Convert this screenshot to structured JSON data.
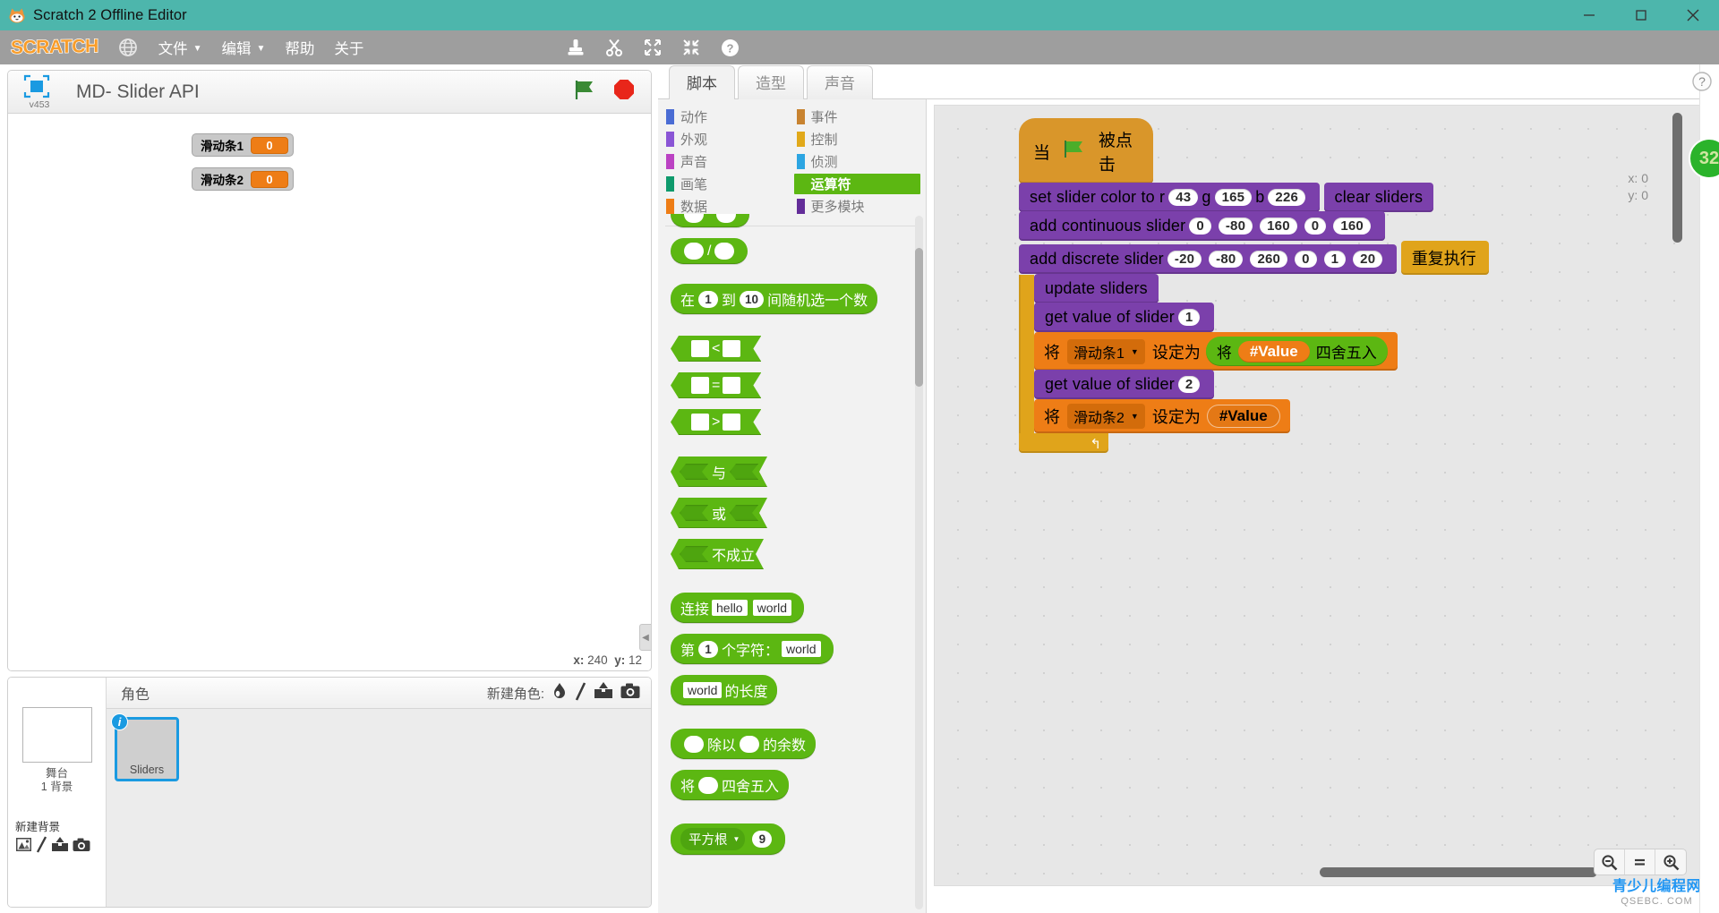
{
  "window": {
    "title": "Scratch 2 Offline Editor",
    "controls": {
      "minimize": "minimize-icon",
      "maximize": "maximize-icon",
      "close": "close-icon"
    }
  },
  "menubar": {
    "logo": "SCRATCH",
    "globe_icon": "globe-icon",
    "items": [
      {
        "label": "文件",
        "has_caret": true
      },
      {
        "label": "编辑",
        "has_caret": true
      },
      {
        "label": "帮助",
        "has_caret": false
      },
      {
        "label": "关于",
        "has_caret": false
      }
    ],
    "tools": [
      "stamp-duplicate-icon",
      "scissors-delete-icon",
      "grow-icon",
      "shrink-icon",
      "help-icon"
    ]
  },
  "stage": {
    "project_title": "MD- Slider API",
    "version_badge": "v453",
    "green_flag_icon": "green-flag-icon",
    "stop_icon": "stop-sign-icon",
    "watchers": [
      {
        "name": "滑动条1",
        "value": "0"
      },
      {
        "name": "滑动条2",
        "value": "0"
      }
    ],
    "mouse_x_label": "x:",
    "mouse_x": "240",
    "mouse_y_label": "y:",
    "mouse_y": "12"
  },
  "sprite_pane": {
    "stage_label": "舞台",
    "stage_sub": "1 背景",
    "new_backdrop_label": "新建背景",
    "backdrop_icons": [
      "library-picture-icon",
      "paint-icon",
      "upload-icon",
      "camera-icon"
    ],
    "header": "角色",
    "new_sprite_label": "新建角色:",
    "new_sprite_icons": [
      "library-sprite-icon",
      "paint-icon",
      "upload-icon",
      "camera-icon"
    ],
    "sprites": [
      {
        "name": "Sliders",
        "selected": true,
        "info_badge": "i"
      }
    ]
  },
  "editor": {
    "tabs": [
      {
        "label": "脚本",
        "active": true
      },
      {
        "label": "造型",
        "active": false
      },
      {
        "label": "声音",
        "active": false
      }
    ],
    "categories": [
      {
        "label": "动作",
        "color": "#4a6cd4",
        "active": false
      },
      {
        "label": "事件",
        "color": "#c88330",
        "active": false
      },
      {
        "label": "外观",
        "color": "#8a55d5",
        "active": false
      },
      {
        "label": "控制",
        "color": "#e1a91a",
        "active": false
      },
      {
        "label": "声音",
        "color": "#bb42c3",
        "active": false
      },
      {
        "label": "侦测",
        "color": "#2ca5e2",
        "active": false
      },
      {
        "label": "画笔",
        "color": "#0e9a6c",
        "active": false
      },
      {
        "label": "运算符",
        "color": "#5cb712",
        "active": true
      },
      {
        "label": "数据",
        "color": "#ee7d16",
        "active": false
      },
      {
        "label": "更多模块",
        "color": "#632d99",
        "active": false
      }
    ],
    "palette_blocks": {
      "multiply_op": "*",
      "divide_op": "/",
      "random": {
        "pre": "在",
        "from": "1",
        "mid": "到",
        "to": "10",
        "post": "间随机选一个数"
      },
      "less_than": "<",
      "equals": "=",
      "greater_than": ">",
      "and": "与",
      "or": "或",
      "not": "不成立",
      "join": {
        "label": "连接",
        "a": "hello",
        "b": "world"
      },
      "letter_of": {
        "pre": "第",
        "n": "1",
        "mid": "个字符：",
        "str": "world"
      },
      "length_of": {
        "str": "world",
        "post": "的长度"
      },
      "mod": {
        "pre": "除以",
        "post": "的余数"
      },
      "round": {
        "pre": "将",
        "post": "四舍五入"
      },
      "mathop": {
        "fn": "平方根",
        "n": "9"
      }
    },
    "script": {
      "hat": {
        "pre": "当",
        "icon": "green-flag-icon",
        "post": "被点击"
      },
      "set_color": {
        "pre": "set slider color to r",
        "r": "43",
        "g_label": "g",
        "g": "165",
        "b_label": "b",
        "b": "226"
      },
      "clear": "clear sliders",
      "add_continuous": {
        "label": "add continuous slider",
        "args": [
          "0",
          "-80",
          "160",
          "0",
          "160"
        ]
      },
      "add_discrete": {
        "label": "add discrete slider",
        "args": [
          "-20",
          "-80",
          "260",
          "0",
          "1",
          "20"
        ]
      },
      "forever": "重复执行",
      "update": "update sliders",
      "get_slider_1": {
        "label": "get value of slider",
        "n": "1"
      },
      "set_var_1": {
        "pre": "将",
        "var": "滑动条1",
        "mid": "设定为",
        "round_pre": "将",
        "value": "#Value",
        "round_post": "四舍五入"
      },
      "get_slider_2": {
        "label": "get value of slider",
        "n": "2"
      },
      "set_var_2": {
        "pre": "将",
        "var": "滑动条2",
        "mid": "设定为",
        "value": "#Value"
      }
    },
    "canvas_coords": {
      "x_label": "x: 0",
      "y_label": "y: 0"
    },
    "zoom_controls": [
      "zoom-out-icon",
      "zoom-reset-icon",
      "zoom-in-icon"
    ],
    "help_icon": "help-question-icon",
    "badge_value": "32"
  },
  "watermark": {
    "line1": "青少儿编程网",
    "line2": "QSEBC. COM"
  },
  "colors": {
    "titlebar": "#4db6ac",
    "menubar": "#9e9e9e",
    "operators": "#5cb712",
    "events": "#d9962a",
    "control": "#e0a41b",
    "data": "#ee7d16",
    "more_blocks": "#7b40ab",
    "selected_sprite": "#1a9ae1"
  }
}
